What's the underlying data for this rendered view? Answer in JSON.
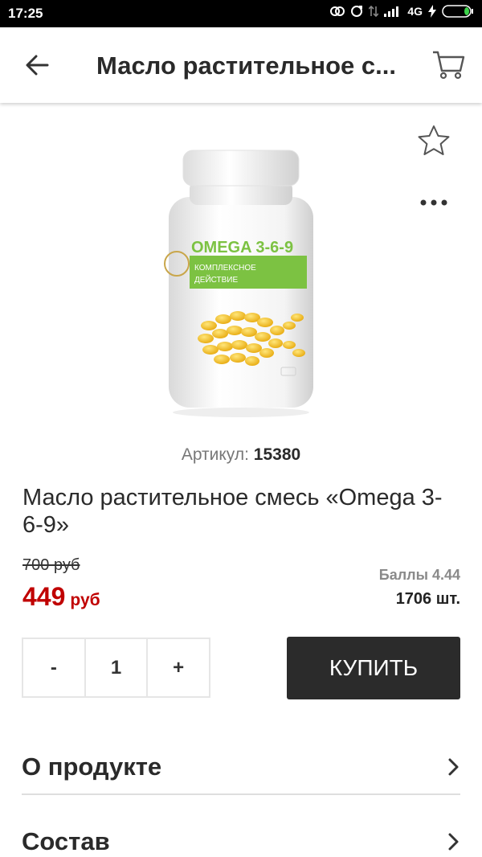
{
  "status_bar": {
    "time": "17:25",
    "network": "4G",
    "icons": [
      "sync-icon",
      "refresh-icon",
      "data-arrows-icon",
      "signal-icon",
      "charging-icon",
      "battery-icon"
    ]
  },
  "app_bar": {
    "title": "Масло растительное с...",
    "icons": [
      "back-arrow-icon",
      "cart-icon"
    ]
  },
  "product": {
    "image_label_brand": "OMEGA 3-6-9",
    "image_label_sub1": "КОМПЛЕКСНОЕ",
    "image_label_sub2": "ДЕЙСТВИЕ",
    "sku_label": "Артикул:",
    "sku_value": "15380",
    "name": "Масло растительное смесь «Omega 3-6-9»",
    "old_price": "700 руб",
    "price_value": "449",
    "price_currency": "руб",
    "points": "Баллы 4.44",
    "stock": "1706 шт."
  },
  "actions": {
    "icons": [
      "star-outline-icon",
      "more-dots-icon"
    ]
  },
  "cart_controls": {
    "minus": "-",
    "quantity": "1",
    "plus": "+",
    "buy_label": "КУПИТЬ"
  },
  "sections": [
    {
      "label": "О продукте"
    },
    {
      "label": "Состав"
    }
  ],
  "colors": {
    "price_red": "#c00000",
    "buy_button": "#2b2b2b",
    "label_green": "#7cc242",
    "capsule_yellow": "#f5c518"
  }
}
